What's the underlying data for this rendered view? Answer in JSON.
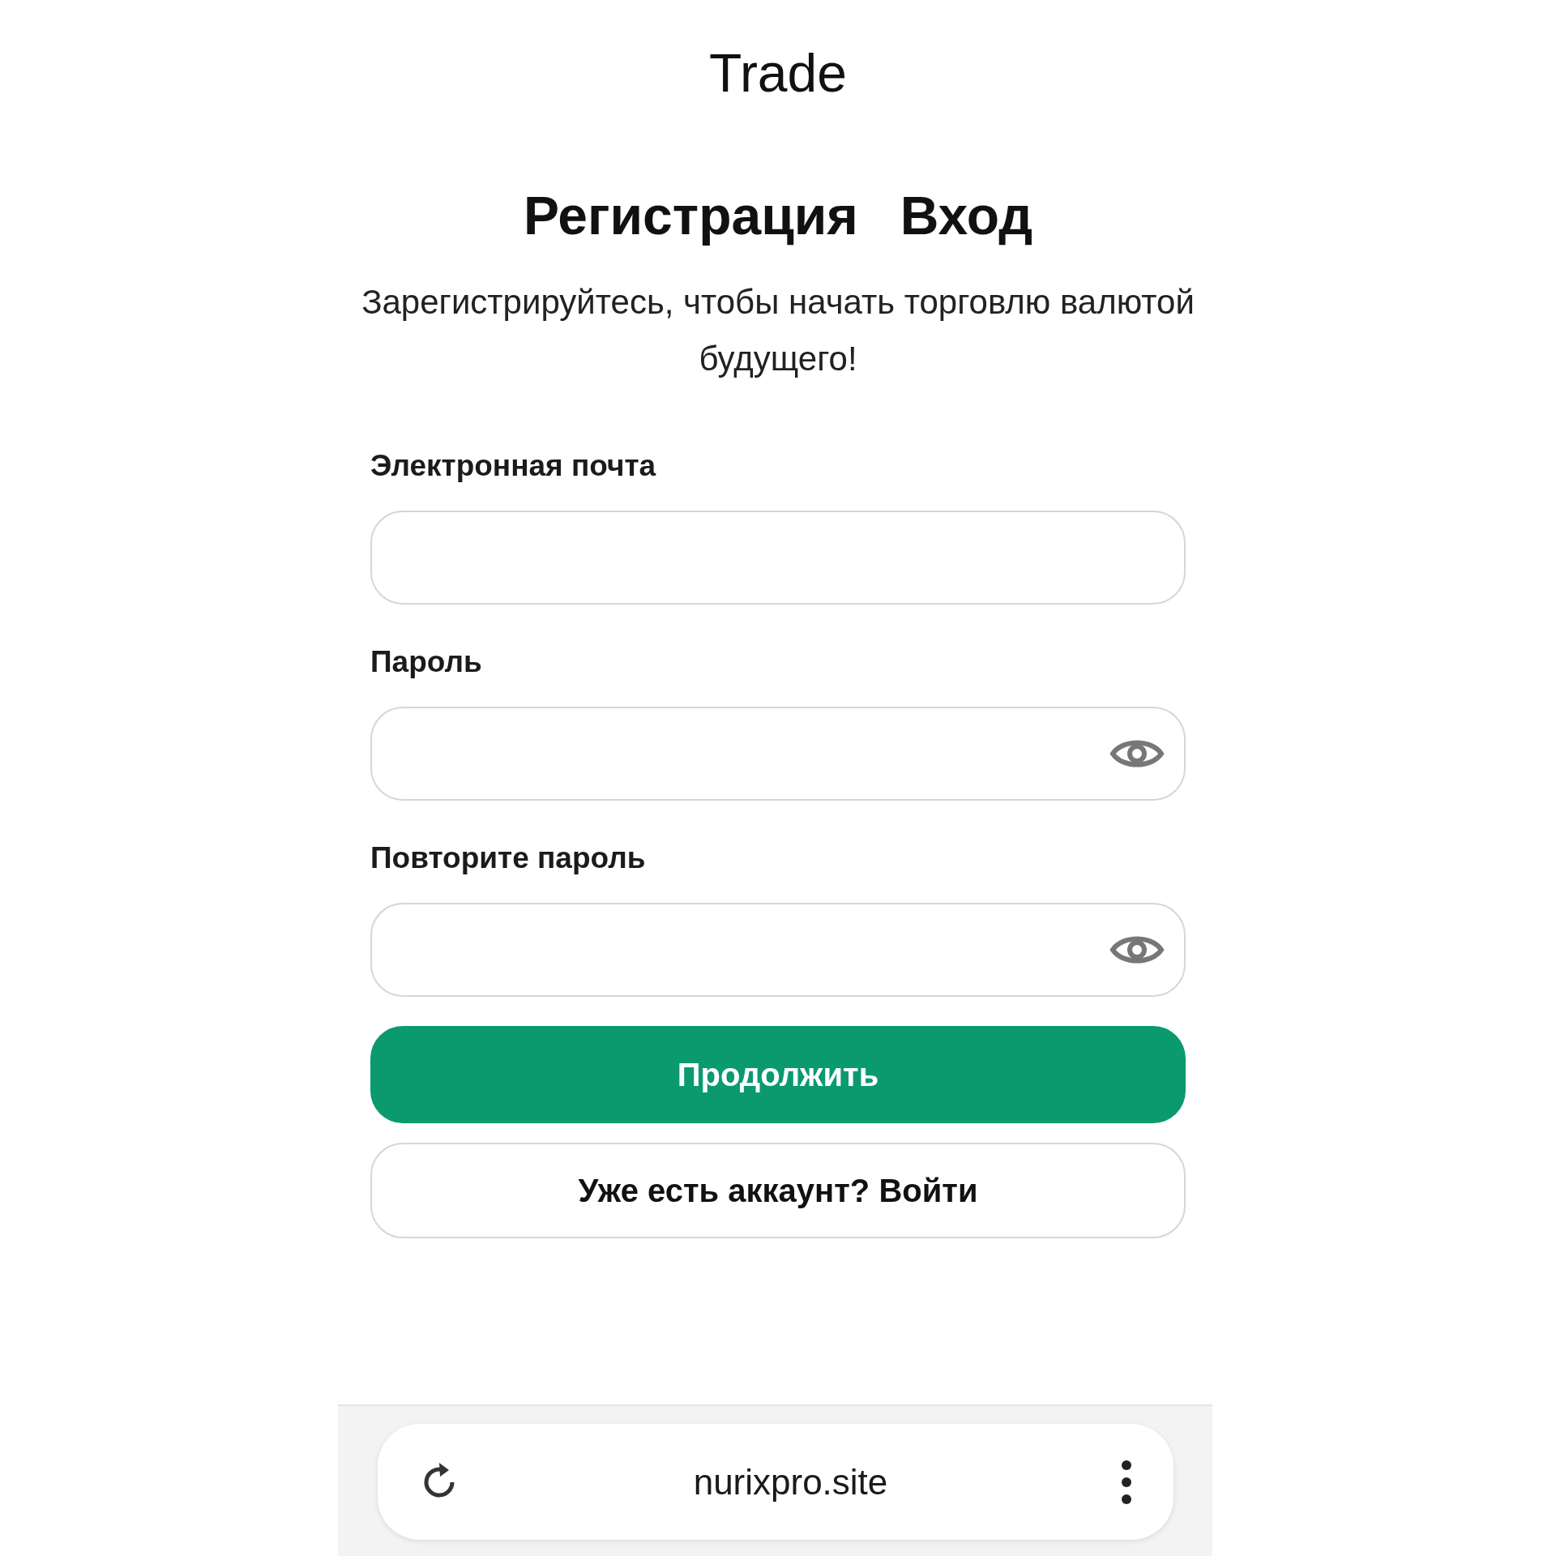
{
  "header": {
    "title": "Trade"
  },
  "tabs": [
    {
      "label": "Регистрация"
    },
    {
      "label": "Вход"
    }
  ],
  "subtitle": "Зарегистрируйтесь, чтобы начать торговлю валютой будущего!",
  "fields": [
    {
      "label": "Электронная почта",
      "kind": "text"
    },
    {
      "label": "Пароль",
      "kind": "password"
    },
    {
      "label": "Повторите пароль",
      "kind": "password"
    }
  ],
  "primary_button": "Продолжить",
  "secondary_button": "Уже есть аккаунт? Войти",
  "browser_bar": {
    "url": "nurixpro.site"
  }
}
